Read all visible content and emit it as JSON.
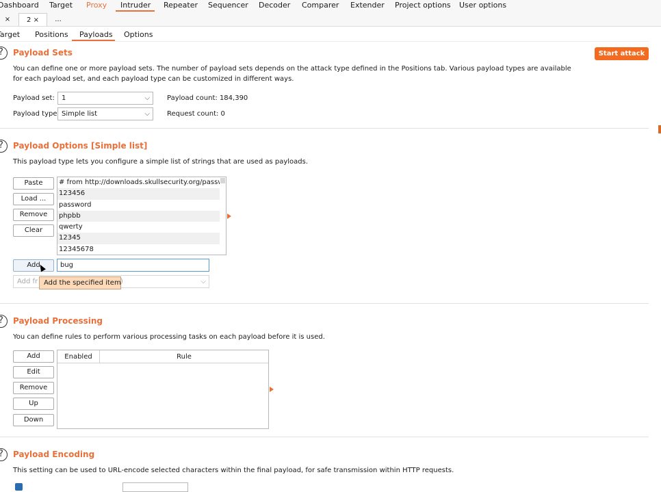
{
  "tool_tabs": [
    {
      "label": "Dashboard"
    },
    {
      "label": "Target"
    },
    {
      "label": "Proxy"
    },
    {
      "label": "Intruder"
    },
    {
      "label": "Repeater"
    },
    {
      "label": "Sequencer"
    },
    {
      "label": "Decoder"
    },
    {
      "label": "Comparer"
    },
    {
      "label": "Extender"
    },
    {
      "label": "Project options"
    },
    {
      "label": "User options"
    }
  ],
  "attack_tabs": {
    "first_close": "×",
    "second": "2 ×",
    "more": "..."
  },
  "sub_tabs": [
    {
      "label": "Target"
    },
    {
      "label": "Positions"
    },
    {
      "label": "Payloads"
    },
    {
      "label": "Options"
    }
  ],
  "payload_sets": {
    "title": "Payload Sets",
    "description": "You can define one or more payload sets. The number of payload sets depends on the attack type defined in the Positions tab. Various payload types are available for each payload set, and each payload type can be customized in different ways.",
    "start_attack": "Start attack",
    "payload_set_label": "Payload set:",
    "payload_set_value": "1",
    "payload_type_label": "Payload type:",
    "payload_type_value": "Simple list",
    "payload_count": "Payload count: 184,390",
    "request_count": "Request count: 0"
  },
  "payload_options": {
    "title": "Payload Options [Simple list]",
    "description": "This payload type lets you configure a simple list of strings that are used as payloads.",
    "buttons": {
      "paste": "Paste",
      "load": "Load ...",
      "remove": "Remove",
      "clear": "Clear",
      "add": "Add"
    },
    "items": [
      "# from http://downloads.skullsecurity.org/passw...",
      "123456",
      "password",
      "phpbb",
      "qwerty",
      "12345",
      "12345678"
    ],
    "add_input_value": "bug",
    "add_from_list_visible": "Add fr",
    "add_from_list_tail": ")",
    "tooltip": "Add the specified item"
  },
  "payload_processing": {
    "title": "Payload Processing",
    "description": "You can define rules to perform various processing tasks on each payload before it is used.",
    "buttons": {
      "add": "Add",
      "edit": "Edit",
      "remove": "Remove",
      "up": "Up",
      "down": "Down"
    },
    "columns": [
      "Enabled",
      "Rule"
    ]
  },
  "payload_encoding": {
    "title": "Payload Encoding",
    "description": "This setting can be used to URL-encode selected characters within the final payload, for safe transmission within HTTP requests."
  },
  "colors": {
    "accent": "#e8703a",
    "start_button": "#f26b21",
    "tooltip_bg": "#fcd9b8"
  }
}
